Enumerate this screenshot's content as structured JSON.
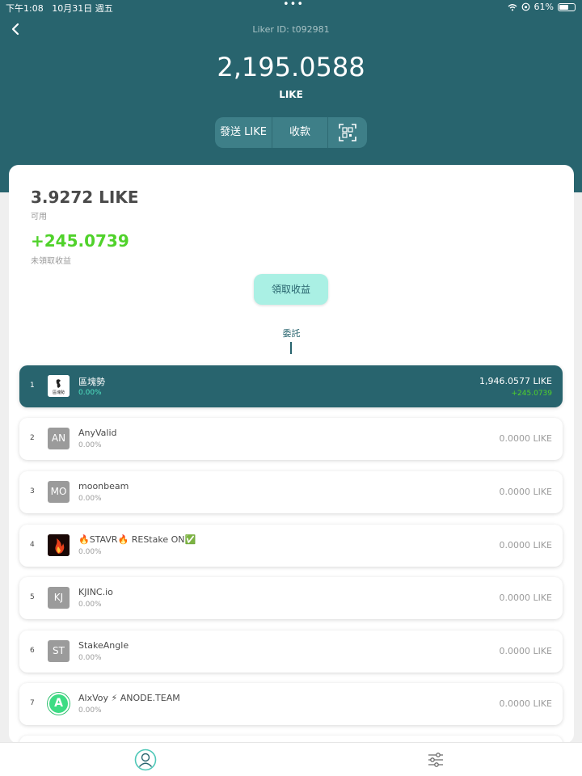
{
  "status": {
    "time": "下午1:08",
    "date": "10月31日 週五",
    "dots": "•••",
    "battery": "61%",
    "battery_level": 0.61
  },
  "header": {
    "liker_id": "Liker ID: t092981",
    "balance": "2,195.0588",
    "unit": "LIKE",
    "send_label": "發送 LIKE",
    "receive_label": "收款"
  },
  "summary": {
    "available_value": "3.9272 LIKE",
    "available_label": "可用",
    "reward_value": "+245.0739",
    "reward_label": "未領取收益",
    "claim_label": "領取收益"
  },
  "tab": {
    "label": "委託"
  },
  "validators": [
    {
      "rank": "1",
      "name": "區塊勢",
      "pct": "0.00%",
      "amount": "1,946.0577 LIKE",
      "reward": "+245.0739",
      "avatar": "",
      "logo_text": "區塊勢",
      "active": true
    },
    {
      "rank": "2",
      "name": "AnyValid",
      "pct": "0.00%",
      "amount": "0.0000 LIKE",
      "avatar": "AN"
    },
    {
      "rank": "3",
      "name": "moonbeam",
      "pct": "0.00%",
      "amount": "0.0000 LIKE",
      "avatar": "MO"
    },
    {
      "rank": "4",
      "name": "🔥STAVR🔥 REStake ON✅",
      "pct": "0.00%",
      "amount": "0.0000 LIKE",
      "avatar": ""
    },
    {
      "rank": "5",
      "name": "KJINC.io",
      "pct": "0.00%",
      "amount": "0.0000 LIKE",
      "avatar": "KJ"
    },
    {
      "rank": "6",
      "name": "StakeAngle",
      "pct": "0.00%",
      "amount": "0.0000 LIKE",
      "avatar": "ST"
    },
    {
      "rank": "7",
      "name": "AlxVoy ⚡ ANODE.TEAM",
      "pct": "0.00%",
      "amount": "0.0000 LIKE",
      "avatar": "A"
    }
  ],
  "colors": {
    "primary": "#28646e",
    "accent": "#aaf0e4",
    "reward": "#50d22b"
  },
  "icons": {
    "back": "chevron-left-icon",
    "scan": "qr-scan-icon",
    "profile": "user-circle-icon",
    "settings": "sliders-icon"
  }
}
